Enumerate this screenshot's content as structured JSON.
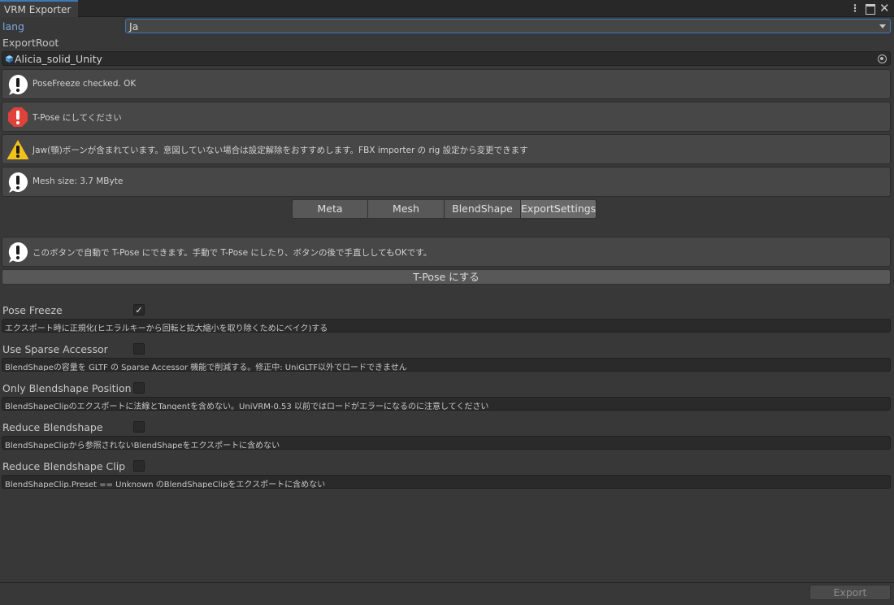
{
  "window": {
    "tab_title": "VRM Exporter"
  },
  "lang": {
    "label": "lang",
    "value": "Ja"
  },
  "export_root": {
    "label": "ExportRoot",
    "value": "Alicia_solid_Unity"
  },
  "messages": [
    {
      "type": "info",
      "text": "PoseFreeze checked. OK"
    },
    {
      "type": "error",
      "text": "T-Pose にしてください"
    },
    {
      "type": "warning",
      "text": "Jaw(顎)ボーンが含まれています。意図していない場合は設定解除をおすすめします。FBX importer の rig 設定から変更できます"
    },
    {
      "type": "info",
      "text": "Mesh size: 3.7 MByte"
    }
  ],
  "tabs": [
    {
      "label": "Meta",
      "selected": false
    },
    {
      "label": "Mesh",
      "selected": false
    },
    {
      "label": "BlendShape",
      "selected": false
    },
    {
      "label": "ExportSettings",
      "selected": true
    }
  ],
  "tpose_help": "このボタンで自動で T-Pose にできます。手動で T-Pose にしたり、ボタンの後で手直ししてもOKです。",
  "tpose_button": "T-Pose にする",
  "settings": [
    {
      "label": "Pose Freeze",
      "checked": true,
      "description": "エクスポート時に正規化(ヒエラルキーから回転と拡大縮小を取り除くためにベイク)する"
    },
    {
      "label": "Use Sparse Accessor",
      "checked": false,
      "description": "BlendShapeの容量を GLTF の Sparse Accessor 機能で削減する。修正中: UniGLTF以外でロードできません"
    },
    {
      "label": "Only Blendshape Position",
      "checked": false,
      "description": "BlendShapeClipのエクスポートに法線とTangentを含めない。UniVRM-0.53 以前ではロードがエラーになるのに注意してください"
    },
    {
      "label": "Reduce Blendshape",
      "checked": false,
      "description": "BlendShapeClipから参照されないBlendShapeをエクスポートに含めない"
    },
    {
      "label": "Reduce Blendshape Clip",
      "checked": false,
      "description": "BlendShapeClip.Preset == Unknown のBlendShapeClipをエクスポートに含めない"
    }
  ],
  "export_button": "Export",
  "colors": {
    "accent": "#3a79bb",
    "error": "#e0413a",
    "warning": "#f2c21b",
    "info": "#ffffff"
  }
}
